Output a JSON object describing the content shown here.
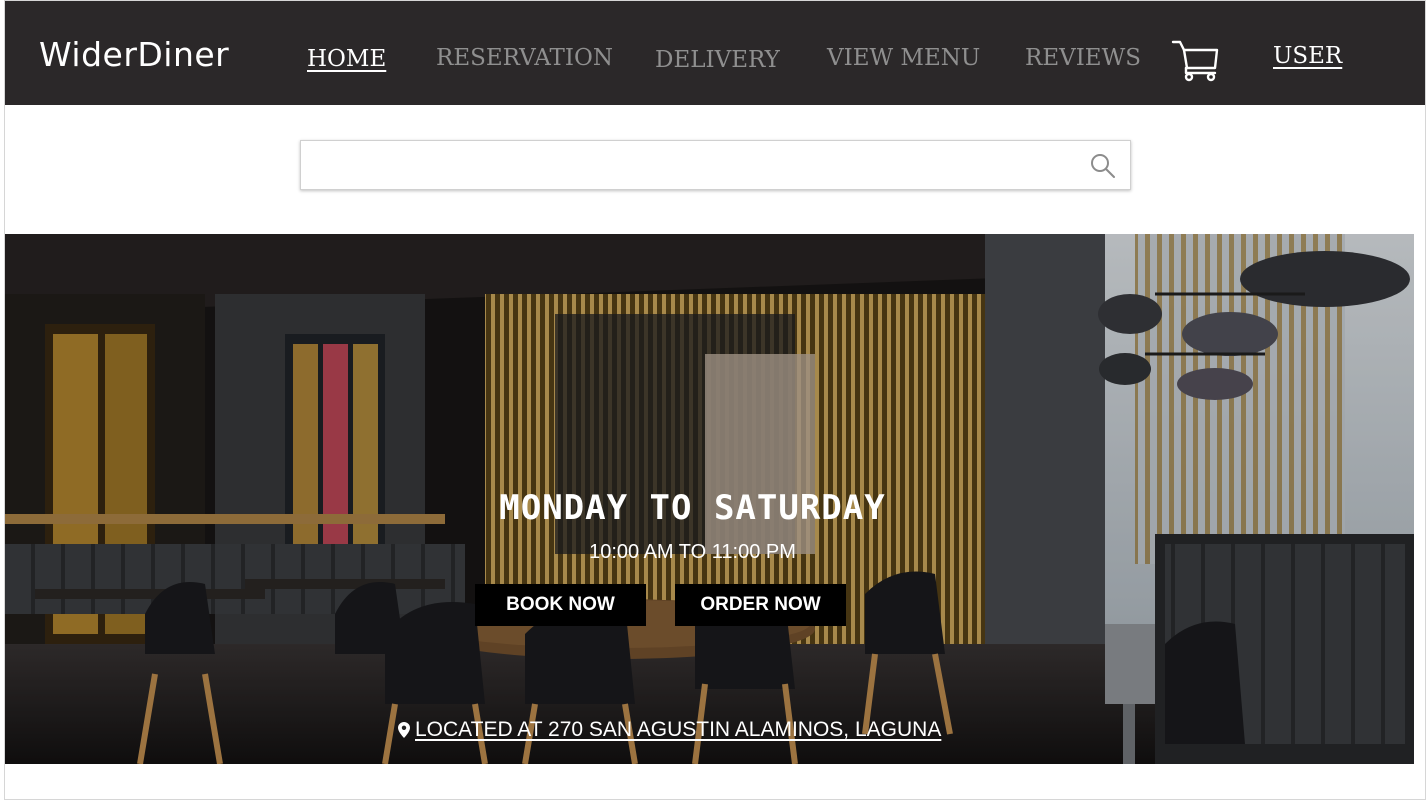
{
  "brand": "WiderDiner",
  "nav": {
    "home": "HOME",
    "reservation": "RESERVATION",
    "delivery": "DELIVERY",
    "view_menu": "VIEW MENU",
    "reviews": "REVIEWS",
    "user": "USER",
    "cart_icon": "shopping-cart-icon"
  },
  "search": {
    "value": "",
    "placeholder": "",
    "icon": "search-icon"
  },
  "hero": {
    "image": "restaurant-interior-photo",
    "title": "MONDAY TO SATURDAY",
    "hours": "10:00 AM TO 11:00 PM",
    "book_label": "BOOK NOW",
    "order_label": "ORDER NOW",
    "location_icon": "map-pin-icon",
    "location": "LOCATED AT 270 SAN AGUSTIN ALAMINOS, LAGUNA"
  },
  "colors": {
    "navbar": "#2b2829",
    "nav_inactive": "#8f8f8f",
    "nav_active": "#ffffff",
    "button_bg": "#000000"
  }
}
